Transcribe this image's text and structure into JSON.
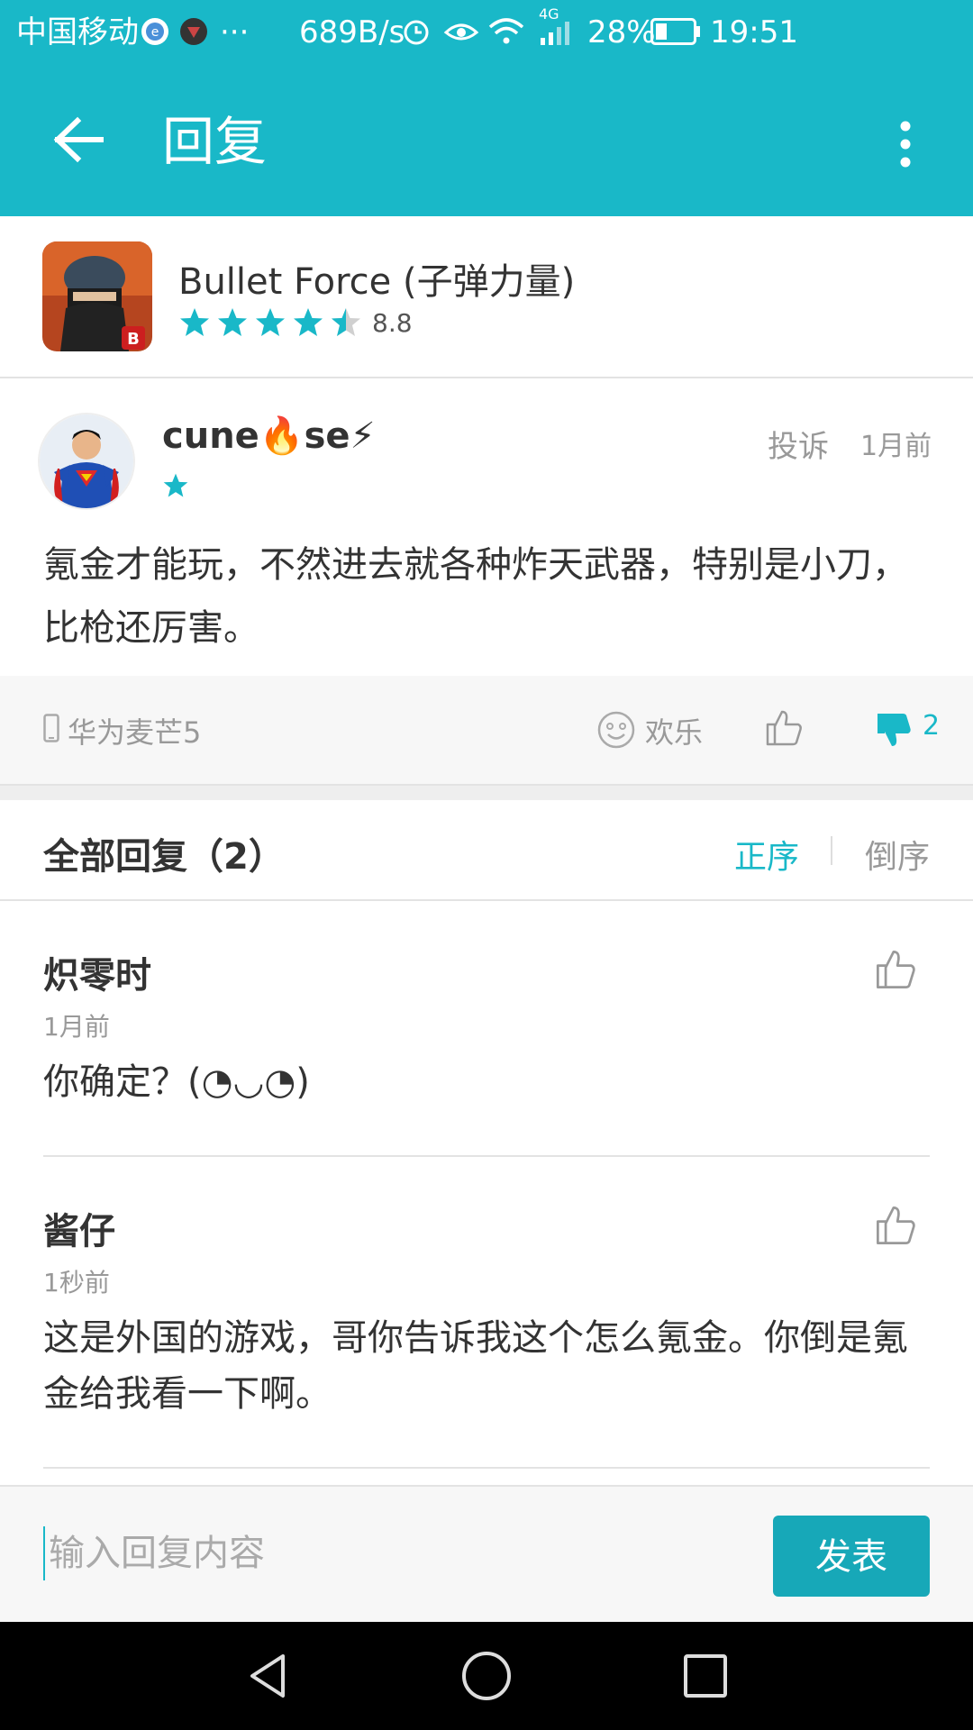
{
  "status_bar": {
    "carrier": "中国移动",
    "more": "···",
    "speed": "689B/s",
    "network": "4G",
    "battery": "28%",
    "time": "19:51"
  },
  "app_bar": {
    "title": "回复"
  },
  "app_info": {
    "name": "Bullet Force (子弹力量)",
    "rating": 8.8,
    "rating_display": "8.8",
    "stars": 4.5
  },
  "review": {
    "author": "cune🔥se⚡",
    "author_stars": 1,
    "report_label": "投诉",
    "time": "1月前",
    "text": "氪金才能玩，不然进去就各种炸天武器，特别是小刀，比枪还厉害。",
    "device": "华为麦芒5",
    "mood_label": "欢乐",
    "dislike_count": "2"
  },
  "replies_header": {
    "title": "全部回复（2）",
    "sort_asc": "正序",
    "sort_desc": "倒序"
  },
  "replies": [
    {
      "name": "炽零时",
      "time": "1月前",
      "text": "你确定？(◔◡◔)"
    },
    {
      "name": "酱仔",
      "time": "1秒前",
      "text": "这是外国的游戏，哥你告诉我这个怎么氪金。你倒是氪金给我看一下啊。"
    }
  ],
  "input_bar": {
    "placeholder": "输入回复内容",
    "submit_label": "发表"
  },
  "colors": {
    "accent": "#19b8c8",
    "button": "#17a8b8"
  }
}
